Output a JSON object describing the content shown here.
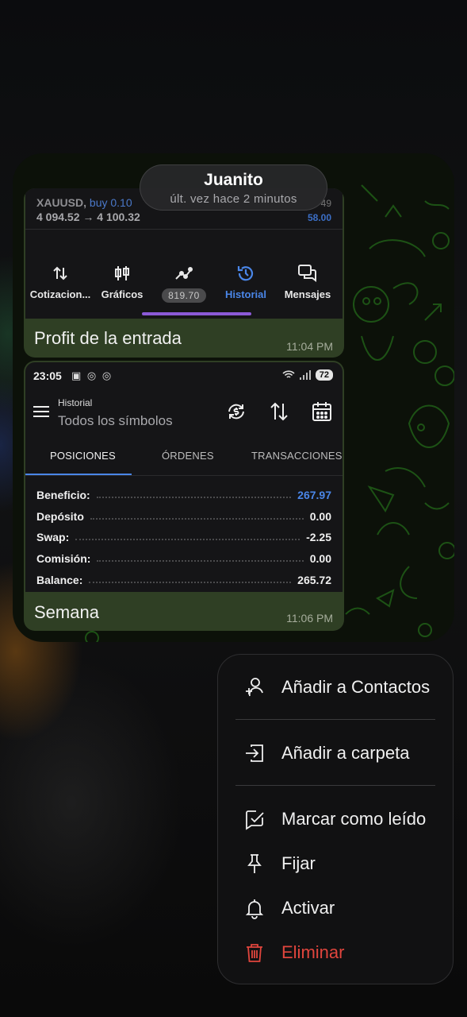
{
  "chat": {
    "name": "Juanito",
    "status": "últ. vez hace 2 minutos"
  },
  "message1": {
    "trade_symbol": "XAUUSD,",
    "trade_side": "buy 0.10",
    "trade_prices": "4 094.52 → 4 100.32",
    "trade_right_top": "49",
    "trade_right_profit": "58.00",
    "nav": [
      {
        "label": "Cotizacion...",
        "icon": "quotes-icon"
      },
      {
        "label": "Gráficos",
        "icon": "candles-icon"
      },
      {
        "label": "819.70",
        "icon": "trade-icon"
      },
      {
        "label": "Historial",
        "icon": "history-icon"
      },
      {
        "label": "Mensajes",
        "icon": "messages-icon"
      }
    ],
    "caption": "Profit de la entrada",
    "time": "11:04 PM"
  },
  "message2": {
    "status_time": "23:05",
    "status_icons": "▣ ◎ ◎",
    "battery": "72",
    "app_title_small": "Historial",
    "app_title_big": "Todos los símbolos",
    "tabs": [
      "POSICIONES",
      "ÓRDENES",
      "TRANSACCIONES"
    ],
    "rows": [
      {
        "label": "Beneficio:",
        "value": "267.97"
      },
      {
        "label": "Depósito",
        "value": "0.00"
      },
      {
        "label": "Swap:",
        "value": "-2.25"
      },
      {
        "label": "Comisión:",
        "value": "0.00"
      },
      {
        "label": "Balance:",
        "value": "265.72"
      }
    ],
    "caption": "Semana",
    "time": "11:06 PM"
  },
  "menu": {
    "items": [
      {
        "label": "Añadir a Contactos",
        "icon": "add-contact-icon"
      },
      {
        "label": "Añadir a carpeta",
        "icon": "folder-move-icon"
      },
      {
        "label": "Marcar como leído",
        "icon": "mark-read-icon"
      },
      {
        "label": "Fijar",
        "icon": "pin-icon"
      },
      {
        "label": "Activar",
        "icon": "bell-icon"
      },
      {
        "label": "Eliminar",
        "icon": "trash-icon"
      }
    ]
  },
  "colors": {
    "accent_blue": "#4a86e8",
    "danger": "#e0453d",
    "bubble": "#2f3f24",
    "nav_indicator": "#8c5ad8"
  }
}
